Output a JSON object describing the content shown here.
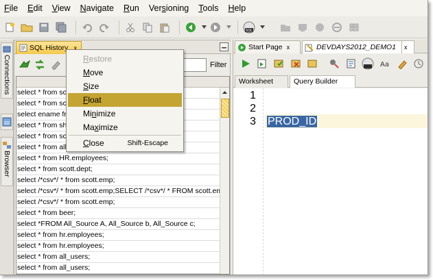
{
  "menubar": {
    "items": [
      {
        "label": "File",
        "mn": "F",
        "rest": "ile"
      },
      {
        "label": "Edit",
        "mn": "E",
        "rest": "dit"
      },
      {
        "label": "View",
        "mn": "V",
        "rest": "iew"
      },
      {
        "label": "Navigate",
        "mn": "N",
        "rest": "avigate"
      },
      {
        "label": "Run",
        "mn": "R",
        "rest": "un"
      },
      {
        "label": "Versioning",
        "mn": "s",
        "pre": "Ver",
        "rest": "ioning"
      },
      {
        "label": "Tools",
        "mn": "T",
        "rest": "ools"
      },
      {
        "label": "Help",
        "mn": "H",
        "rest": "elp"
      }
    ]
  },
  "toolbar": {
    "sql_badge": "SQL"
  },
  "left_strip": {
    "connections": "Connections",
    "browser": "Browser"
  },
  "history": {
    "tab_label": "SQL History",
    "tab_close": "x",
    "filter_label": "Filter",
    "filter_value": "",
    "rows": [
      "select * from scott.emp;",
      "select * from scott.emp;",
      "select ename from scott.emp;",
      "select * from sh.sales;",
      "select * from scott.emp;",
      "select * from all_users;",
      "select * from HR.employees;",
      "select * from scott.dept;",
      "select /*csv*/ * from scott.emp;",
      "select /*csv*/ * from scott.emp;SELECT /*csv*/ * FROM scott.emp;",
      "select /*csv*/ * from scott.emp;",
      "select * from beer;",
      "select *FROM All_Source A, All_Source b, All_Source c;",
      "select * from hr.employees;",
      "select * from hr.employees;",
      "select * from all_users;",
      "select * from all_users;"
    ]
  },
  "context_menu": {
    "items": [
      {
        "label": "Restore",
        "mn": "R",
        "rest": "estore",
        "enabled": false
      },
      {
        "label": "Move",
        "mn": "M",
        "rest": "ove",
        "enabled": true
      },
      {
        "label": "Size",
        "mn": "S",
        "rest": "ize",
        "enabled": true
      },
      {
        "label": "Float",
        "mn": "F",
        "rest": "loat",
        "enabled": true,
        "highlighted": true
      },
      {
        "label": "Minimize",
        "mn": "n",
        "pre": "Mi",
        "rest": "imize",
        "enabled": true
      },
      {
        "label": "Maximize",
        "mn": "x",
        "pre": "Ma",
        "rest": "imize",
        "enabled": true
      }
    ],
    "close": {
      "label": "Close",
      "mn": "C",
      "rest": "lose",
      "shortcut": "Shift-Escape"
    }
  },
  "worksheet": {
    "tabs": [
      {
        "label": "Start Page",
        "close": "x"
      },
      {
        "label": "DEVDAYS2012_DEMO1",
        "close": "x"
      }
    ],
    "subtabs": [
      "Worksheet",
      "Query Builder"
    ],
    "line_numbers": [
      "1",
      "2",
      "3"
    ],
    "code_line3": "PROD_ID"
  },
  "colors": {
    "accent_tab": "#f4c94a",
    "menu_highlight": "#c4a433",
    "selection": "#3a67a3"
  }
}
